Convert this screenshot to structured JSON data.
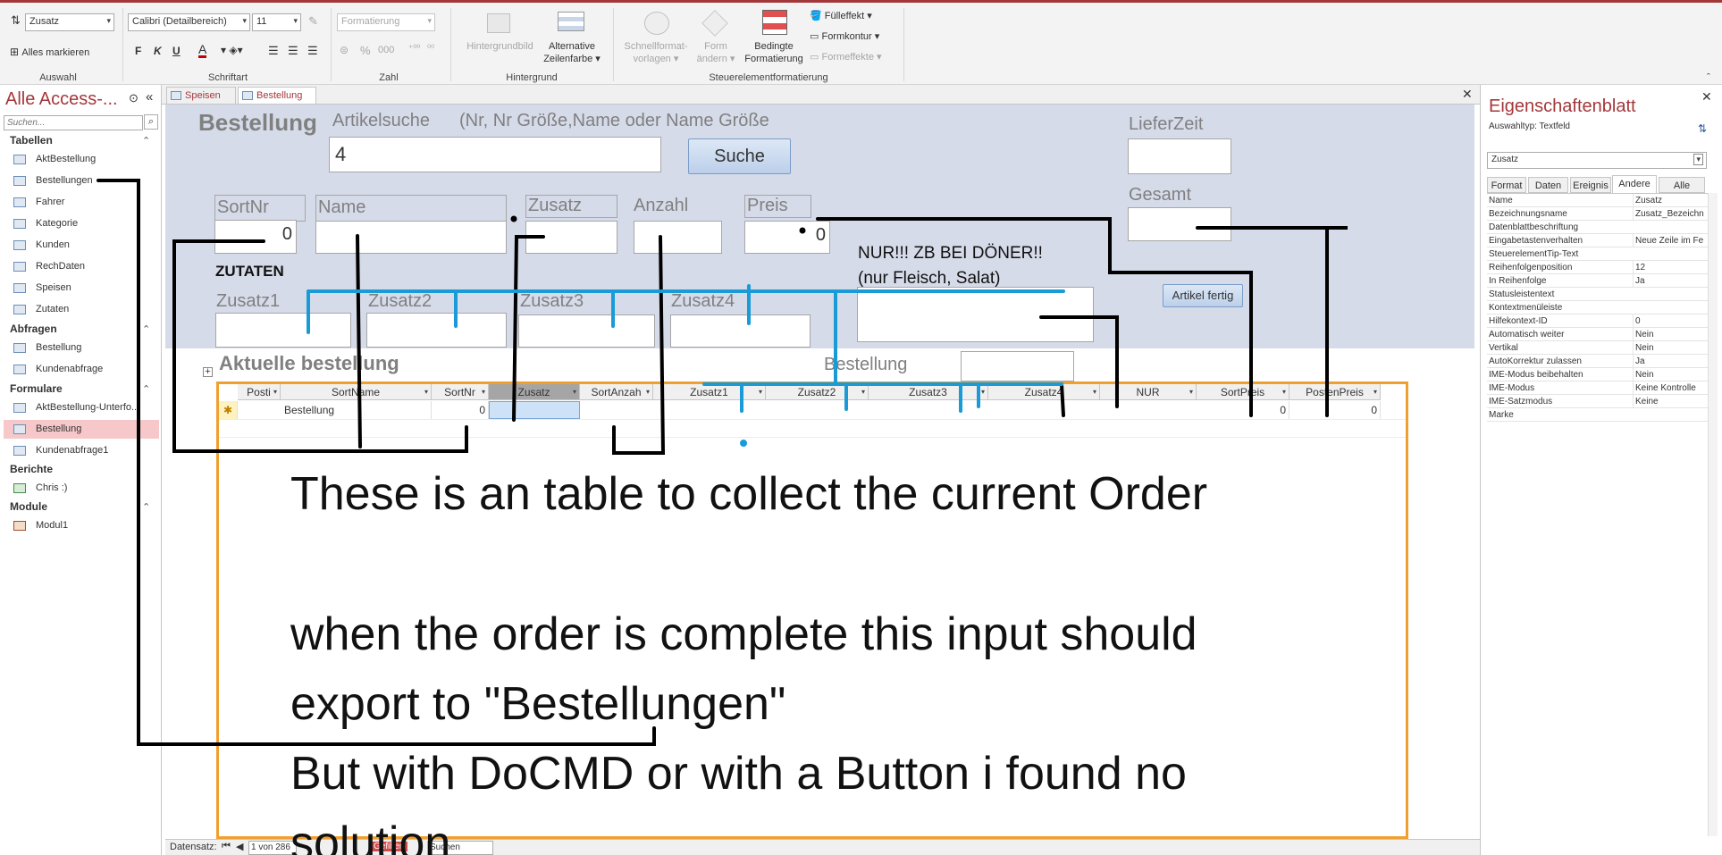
{
  "ribbon": {
    "auswahl": {
      "combo": "Zusatz",
      "select_all": "Alles markieren",
      "label": "Auswahl"
    },
    "schriftart": {
      "font": "Calibri (Detailbereich)",
      "size": "11",
      "bold": "F",
      "italic": "K",
      "underline": "U",
      "font_color": "A",
      "label": "Schriftart"
    },
    "zahl": {
      "format": "Formatierung",
      "percent": "%",
      "thousands": "000",
      "label": "Zahl"
    },
    "hintergrund": {
      "image": "Hintergrundbild",
      "alt_row_1": "Alternative",
      "alt_row_2": "Zeilenfarbe",
      "label": "Hintergrund"
    },
    "steuerelement": {
      "quick_1": "Schnellformat-",
      "quick_2": "vorlagen",
      "shape_1": "Form",
      "shape_2": "ändern",
      "cond_1": "Bedingte",
      "cond_2": "Formatierung",
      "fill": "Fülleffekt",
      "outline": "Formkontur",
      "effects": "Formeffekte",
      "label": "Steuerelementformatierung"
    }
  },
  "nav": {
    "title": "Alle Access-...",
    "search_placeholder": "Suchen...",
    "groups": {
      "tabellen": {
        "label": "Tabellen",
        "items": [
          "AktBestellung",
          "Bestellungen",
          "Fahrer",
          "Kategorie",
          "Kunden",
          "RechDaten",
          "Speisen",
          "Zutaten"
        ]
      },
      "abfragen": {
        "label": "Abfragen",
        "items": [
          "Bestellung",
          "Kundenabfrage"
        ]
      },
      "formulare": {
        "label": "Formulare",
        "items": [
          "AktBestellung-Unterfo...",
          "Bestellung",
          "Kundenabfrage1"
        ]
      },
      "berichte": {
        "label": "Berichte",
        "items": [
          "Chris :)"
        ]
      },
      "module": {
        "label": "Module",
        "items": [
          "Modul1"
        ]
      }
    }
  },
  "tabs": [
    "Speisen",
    "Bestellung"
  ],
  "form": {
    "title": "Bestellung",
    "artikelsuche": "Artikelsuche",
    "hint": "(Nr, Nr Größe,Name oder Name Größe",
    "search_value": "4",
    "search_button": "Suche",
    "lieferzeit": "LieferZeit",
    "gesamt": "Gesamt",
    "sortnr": "SortNr",
    "sortnr_value": "0",
    "name": "Name",
    "zusatz": "Zusatz",
    "anzahl": "Anzahl",
    "preis": "Preis",
    "preis_value": "0",
    "note_1": "NUR!!! ZB BEI DÖNER!!",
    "note_2": "(nur Fleisch, Salat)",
    "zutaten": "ZUTATEN",
    "zusatz1": "Zusatz1",
    "zusatz2": "Zusatz2",
    "zusatz3": "Zusatz3",
    "zusatz4": "Zusatz4",
    "artikel_fertig": "Artikel fertig",
    "aktuelle": "Aktuelle bestellung",
    "bestellung_lbl": "Bestellung"
  },
  "grid": {
    "columns": [
      "Posti",
      "SortName",
      "SortNr",
      "Zusatz",
      "SortAnzah",
      "Zusatz1",
      "Zusatz2",
      "Zusatz3",
      "Zusatz4",
      "NUR",
      "SortPreis",
      "PostenPreis"
    ],
    "row": {
      "sortname": "Bestellung",
      "sortnr": "0",
      "sortpreis": "0",
      "postenpreis": "0"
    }
  },
  "props": {
    "title": "Eigenschaftenblatt",
    "auswahltyp": "Auswahltyp:  Textfeld",
    "selected": "Zusatz",
    "tabs": [
      "Format",
      "Daten",
      "Ereignis",
      "Andere",
      "Alle"
    ],
    "rows": [
      [
        "Name",
        "Zusatz"
      ],
      [
        "Bezeichnungsname",
        "Zusatz_Bezeichn"
      ],
      [
        "Datenblattbeschriftung",
        ""
      ],
      [
        "Eingabetastenverhalten",
        "Neue Zeile im Fe"
      ],
      [
        "SteuerelementTip-Text",
        ""
      ],
      [
        "Reihenfolgenposition",
        "12"
      ],
      [
        "In Reihenfolge",
        "Ja"
      ],
      [
        "Statusleistentext",
        ""
      ],
      [
        "Kontextmenüleiste",
        ""
      ],
      [
        "Hilfekontext-ID",
        "0"
      ],
      [
        "Automatisch weiter",
        "Nein"
      ],
      [
        "Vertikal",
        "Nein"
      ],
      [
        "AutoKorrektur zulassen",
        "Ja"
      ],
      [
        "IME-Modus beibehalten",
        "Nein"
      ],
      [
        "IME-Modus",
        "Keine Kontrolle"
      ],
      [
        "IME-Satzmodus",
        "Keine"
      ],
      [
        "Marke",
        ""
      ]
    ]
  },
  "status": {
    "label": "Datensatz:",
    "record": "1 von 286",
    "filter": "Gefiltert",
    "search": "Suchen"
  },
  "annotation": {
    "line1": "These is an table to collect the current Order",
    "line2": "when the order is complete this input should",
    "line3": "export to \"Bestellungen\"",
    "line4": "But with DoCMD or with a Button i found no",
    "line5": "solution"
  },
  "colors": {
    "access_red": "#a4373a",
    "header_bg": "#d6dbe9",
    "annotation_blue": "#1a9bd7",
    "grid_border": "#f0a030"
  }
}
